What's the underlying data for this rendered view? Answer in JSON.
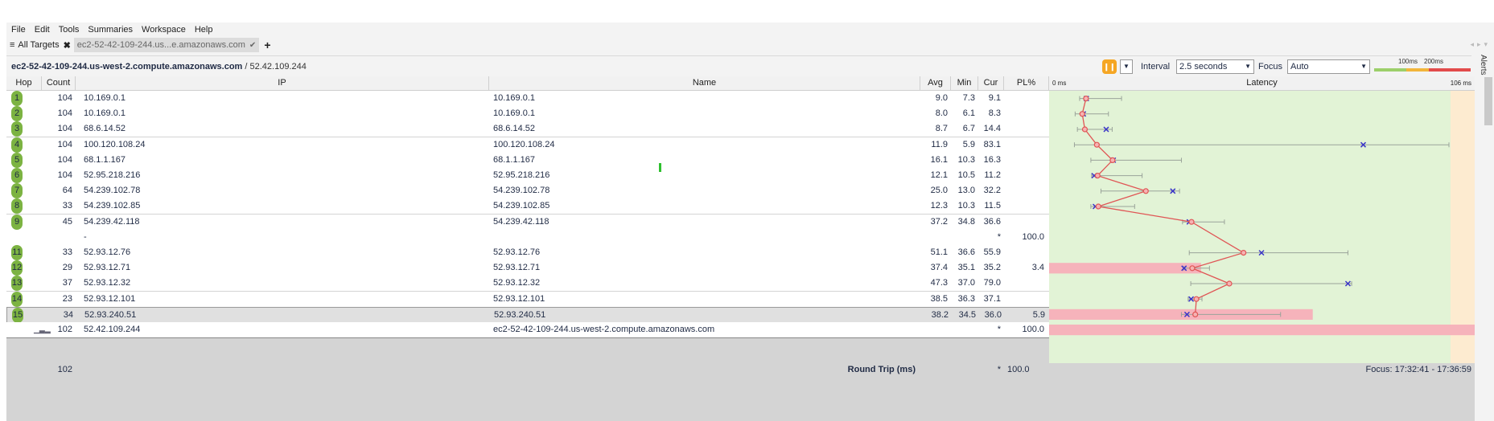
{
  "menu": [
    "File",
    "Edit",
    "Tools",
    "Summaries",
    "Workspace",
    "Help"
  ],
  "tabs": {
    "all_targets": "All Targets",
    "target_tab": "ec2-52-42-109-244.us...e.amazonaws.com"
  },
  "target": {
    "hostname": "ec2-52-42-109-244.us-west-2.compute.amazonaws.com",
    "ip_suffix": " / 52.42.109.244"
  },
  "controls": {
    "interval_label": "Interval",
    "interval_value": "2.5 seconds",
    "focus_label": "Focus",
    "focus_value": "Auto",
    "scale_100": "100ms",
    "scale_200": "200ms",
    "alerts": "Alerts"
  },
  "columns": {
    "hop": "Hop",
    "count": "Count",
    "ip": "IP",
    "name": "Name",
    "avg": "Avg",
    "min": "Min",
    "cur": "Cur",
    "pl": "PL%",
    "latency": "Latency",
    "lat_min": "0 ms",
    "lat_max": "106 ms"
  },
  "rows": [
    {
      "hop": "1",
      "count": "104",
      "ip": "10.169.0.1",
      "name": "10.169.0.1",
      "avg": "9.0",
      "min": "7.3",
      "cur": "9.1",
      "pl": "",
      "plv": 0,
      "avgv": 9.0,
      "minv": 7.3,
      "curv": 9.1,
      "maxv": 18.5
    },
    {
      "hop": "2",
      "count": "104",
      "ip": "10.169.0.1",
      "name": "10.169.0.1",
      "avg": "8.0",
      "min": "6.1",
      "cur": "8.3",
      "pl": "",
      "plv": 0,
      "avgv": 8.0,
      "minv": 6.1,
      "curv": 8.3,
      "maxv": 15.0
    },
    {
      "hop": "3",
      "count": "104",
      "ip": "68.6.14.52",
      "name": "68.6.14.52",
      "avg": "8.7",
      "min": "6.7",
      "cur": "14.4",
      "pl": "",
      "plv": 0,
      "avgv": 8.7,
      "minv": 6.7,
      "curv": 14.4,
      "maxv": 16.0
    },
    {
      "hop": "4",
      "count": "104",
      "ip": "100.120.108.24",
      "name": "100.120.108.24",
      "avg": "11.9",
      "min": "5.9",
      "cur": "83.1",
      "pl": "",
      "plv": 0,
      "avgv": 11.9,
      "minv": 5.9,
      "curv": 83.1,
      "maxv": 106.0
    },
    {
      "hop": "5",
      "count": "104",
      "ip": "68.1.1.167",
      "name": "68.1.1.167",
      "avg": "16.1",
      "min": "10.3",
      "cur": "16.3",
      "pl": "",
      "plv": 0,
      "avgv": 16.1,
      "minv": 10.3,
      "curv": 16.3,
      "maxv": 34.5
    },
    {
      "hop": "6",
      "count": "104",
      "ip": "52.95.218.216",
      "name": "52.95.218.216",
      "avg": "12.1",
      "min": "10.5",
      "cur": "11.2",
      "pl": "",
      "plv": 0,
      "avgv": 12.1,
      "minv": 10.5,
      "curv": 11.2,
      "maxv": 24.0
    },
    {
      "hop": "7",
      "count": "64",
      "ip": "54.239.102.78",
      "name": "54.239.102.78",
      "avg": "25.0",
      "min": "13.0",
      "cur": "32.2",
      "pl": "",
      "plv": 0,
      "avgv": 25.0,
      "minv": 13.0,
      "curv": 32.2,
      "maxv": 34.0
    },
    {
      "hop": "8",
      "count": "33",
      "ip": "54.239.102.85",
      "name": "54.239.102.85",
      "avg": "12.3",
      "min": "10.3",
      "cur": "11.5",
      "pl": "",
      "plv": 0,
      "avgv": 12.3,
      "minv": 10.3,
      "curv": 11.5,
      "maxv": 22.0
    },
    {
      "hop": "9",
      "count": "45",
      "ip": "54.239.42.118",
      "name": "54.239.42.118",
      "avg": "37.2",
      "min": "34.8",
      "cur": "36.6",
      "pl": "",
      "plv": 0,
      "avgv": 37.2,
      "minv": 34.8,
      "curv": 36.6,
      "maxv": 46.0
    },
    {
      "hop": "",
      "count": "",
      "ip": "-",
      "name": "",
      "avg": "",
      "min": "",
      "cur": "*",
      "pl": "100.0",
      "plv": 0
    },
    {
      "hop": "11",
      "count": "33",
      "ip": "52.93.12.76",
      "name": "52.93.12.76",
      "avg": "51.1",
      "min": "36.6",
      "cur": "55.9",
      "pl": "",
      "plv": 0,
      "avgv": 51.1,
      "minv": 36.6,
      "curv": 55.9,
      "maxv": 79.0
    },
    {
      "hop": "12",
      "count": "29",
      "ip": "52.93.12.71",
      "name": "52.93.12.71",
      "avg": "37.4",
      "min": "35.1",
      "cur": "35.2",
      "pl": "3.4",
      "plv": 3.4,
      "avgv": 37.4,
      "minv": 35.1,
      "curv": 35.2,
      "maxv": 42.0
    },
    {
      "hop": "13",
      "count": "37",
      "ip": "52.93.12.32",
      "name": "52.93.12.32",
      "avg": "47.3",
      "min": "37.0",
      "cur": "79.0",
      "pl": "",
      "plv": 0,
      "avgv": 47.3,
      "minv": 37.0,
      "curv": 79.0,
      "maxv": 80.0
    },
    {
      "hop": "14",
      "count": "23",
      "ip": "52.93.12.101",
      "name": "52.93.12.101",
      "avg": "38.5",
      "min": "36.3",
      "cur": "37.1",
      "pl": "",
      "plv": 0,
      "avgv": 38.5,
      "minv": 36.3,
      "curv": 37.1,
      "maxv": 40.0
    },
    {
      "hop": "15",
      "count": "34",
      "ip": "52.93.240.51",
      "name": "52.93.240.51",
      "avg": "38.2",
      "min": "34.5",
      "cur": "36.0",
      "pl": "5.9",
      "plv": 5.9,
      "avgv": 38.2,
      "minv": 34.5,
      "curv": 36.0,
      "maxv": 61.0
    },
    {
      "hop": "",
      "count": "102",
      "ip": "52.42.109.244",
      "name": "ec2-52-42-109-244.us-west-2.compute.amazonaws.com",
      "avg": "",
      "min": "",
      "cur": "*",
      "pl": "100.0",
      "plv": 100
    }
  ],
  "summary": {
    "count": "102",
    "label": "Round Trip (ms)",
    "cur": "*",
    "pl": "100.0",
    "focus": "Focus: 17:32:41 - 17:36:59"
  },
  "colors": {
    "accent_pause": "#f5a623",
    "hop_badge": "#7cb342",
    "latency_bg": "#e2f3d6",
    "latency_warn": "#fdebd0",
    "loss_bar": "#f6b3bb",
    "avg_line": "#e05555"
  }
}
